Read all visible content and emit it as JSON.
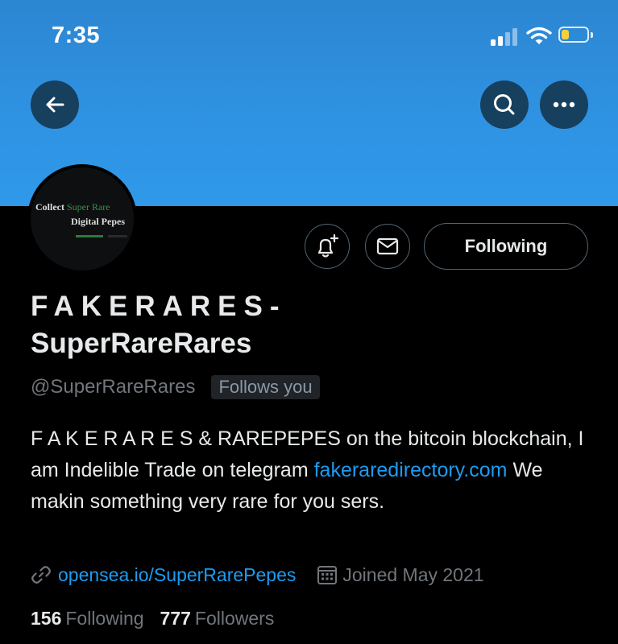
{
  "colors": {
    "banner": "#2f93e3",
    "background": "#000000",
    "accent_link": "#1d9bf0",
    "muted_text": "#71767b",
    "battery_level": "#f4d03f"
  },
  "status_bar": {
    "time": "7:35",
    "signal_bars_active": 2,
    "signal_bars_total": 4,
    "battery_level": 0.3
  },
  "header": {
    "back_icon": "arrow-left-icon",
    "search_icon": "search-icon",
    "more_icon": "more-horizontal-icon"
  },
  "avatar": {
    "line1_a": "Collect ",
    "line1_b": "Super Rare",
    "line2": "Digital Pepes"
  },
  "actions": {
    "notify_icon": "bell-plus-icon",
    "message_icon": "envelope-icon",
    "following_label": "Following"
  },
  "profile": {
    "name_line1": "FAKERARES-",
    "name_line2": "SuperRareRares",
    "handle": "@SuperRareRares",
    "follows_you": "Follows you"
  },
  "bio": {
    "text1": "F A K E R A R E S & RAREPEPES on the bitcoin blockchain, I am Indelible Trade on telegram ",
    "link": "fakeraredirectory.com",
    "text2": " We makin something very rare for you sers."
  },
  "meta": {
    "website": "opensea.io/SuperRarePepes",
    "joined": "Joined May 2021",
    "link_icon": "link-icon",
    "calendar_icon": "calendar-icon"
  },
  "stats": {
    "following_count": "156",
    "following_label": "Following",
    "followers_count": "777",
    "followers_label": "Followers"
  }
}
